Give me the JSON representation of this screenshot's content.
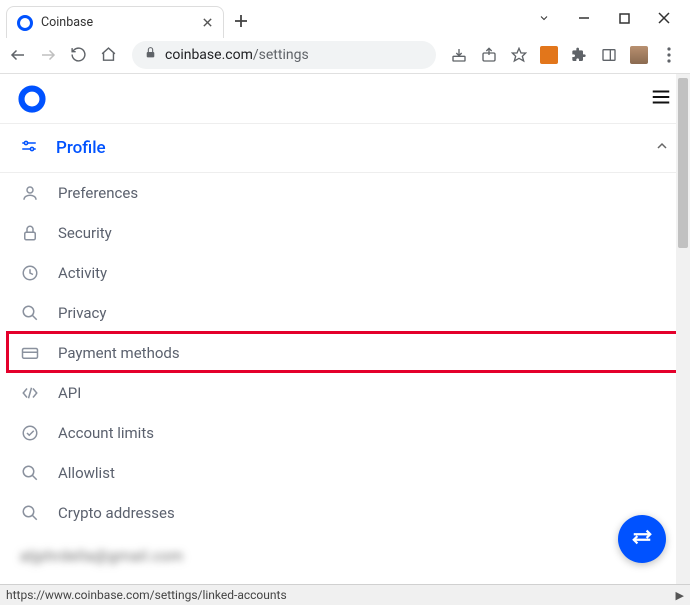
{
  "browser": {
    "tab_title": "Coinbase",
    "url_host": "coinbase.com",
    "url_path": "/settings",
    "status_url": "https://www.coinbase.com/settings/linked-accounts"
  },
  "header": {
    "active_section": "Profile"
  },
  "menu": {
    "items": [
      {
        "label": "Preferences"
      },
      {
        "label": "Security"
      },
      {
        "label": "Activity"
      },
      {
        "label": "Privacy"
      },
      {
        "label": "Payment methods"
      },
      {
        "label": "API"
      },
      {
        "label": "Account limits"
      },
      {
        "label": "Allowlist"
      },
      {
        "label": "Crypto addresses"
      }
    ]
  },
  "blurred_text": "aljphrdella@gmail.com"
}
